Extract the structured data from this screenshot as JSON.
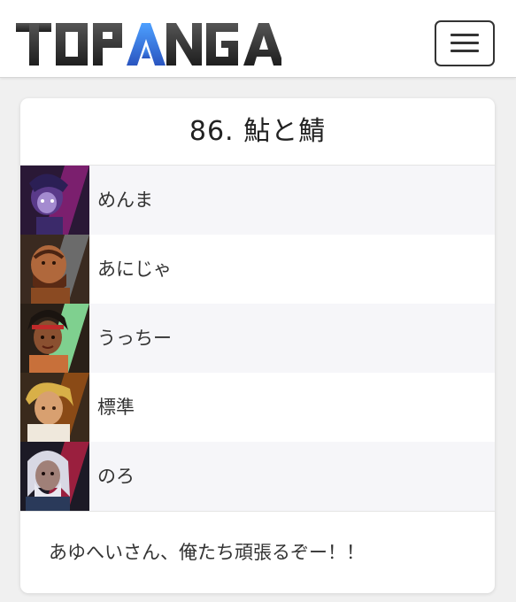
{
  "header": {
    "logo_text": "TOPANGA",
    "menu_icon": "hamburger-menu-icon"
  },
  "team": {
    "title": "86. 鮎と鯖",
    "players": [
      {
        "name": "めんま",
        "character_icon": "character-portrait-icon",
        "accent": "#7b1f6e"
      },
      {
        "name": "あにじゃ",
        "character_icon": "character-portrait-icon",
        "accent": "#6b6b6b"
      },
      {
        "name": "うっちー",
        "character_icon": "character-portrait-icon",
        "accent": "#7fd08f"
      },
      {
        "name": "標準",
        "character_icon": "character-portrait-icon",
        "accent": "#8a4a16"
      },
      {
        "name": "のろ",
        "character_icon": "character-portrait-icon",
        "accent": "#9a1f3e"
      }
    ],
    "comment": "あゆへいさん、俺たち頑張るぞー！！"
  },
  "colors": {
    "logo_dark": "#2b2b2b",
    "logo_blue": "#3a6fd6",
    "background": "#f0f0f0",
    "card": "#ffffff",
    "row_alt": "#f6f6f9"
  }
}
